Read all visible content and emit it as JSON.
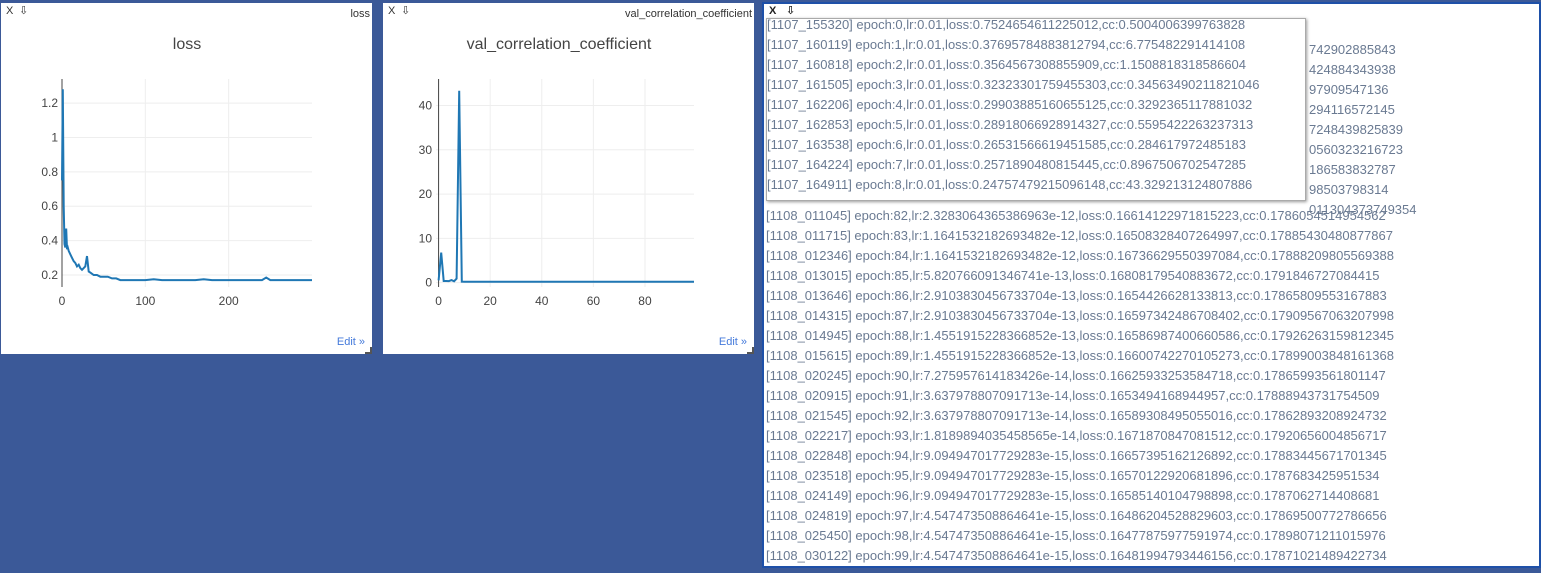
{
  "loss_pane": {
    "close_label": "X",
    "save_icon": "download-icon",
    "small_title": "loss",
    "edit_label": "Edit »",
    "chart_data": {
      "type": "line",
      "title": "loss",
      "xlabel": "",
      "ylabel": "",
      "xlim": [
        0,
        300
      ],
      "ylim": [
        0.13,
        1.34
      ],
      "xticks": [
        0,
        100,
        200
      ],
      "yticks": [
        0.2,
        0.4,
        0.6,
        0.8,
        1,
        1.2
      ],
      "grid": true,
      "color": "#1f77b4",
      "series": [
        {
          "x": [
            0,
            1,
            2,
            3,
            4,
            5,
            6,
            7,
            8,
            9,
            10,
            12,
            14,
            16,
            18,
            20,
            22,
            24,
            26,
            28,
            30,
            32,
            35,
            38,
            42,
            46,
            50,
            55,
            60,
            65,
            70,
            80,
            90,
            100,
            110,
            120,
            140,
            160,
            170,
            180,
            200,
            220,
            240,
            245,
            250,
            270,
            290,
            300
          ],
          "y": [
            0.75,
            1.28,
            0.6,
            0.38,
            0.36,
            0.47,
            0.35,
            0.36,
            0.34,
            0.33,
            0.32,
            0.3,
            0.28,
            0.27,
            0.25,
            0.26,
            0.24,
            0.23,
            0.24,
            0.25,
            0.31,
            0.22,
            0.21,
            0.2,
            0.2,
            0.19,
            0.19,
            0.19,
            0.18,
            0.18,
            0.17,
            0.17,
            0.17,
            0.17,
            0.175,
            0.17,
            0.17,
            0.17,
            0.175,
            0.17,
            0.17,
            0.17,
            0.17,
            0.185,
            0.17,
            0.17,
            0.17,
            0.17
          ]
        }
      ]
    }
  },
  "cc_pane": {
    "close_label": "X",
    "save_icon": "download-icon",
    "small_title": "val_correlation_coefficient",
    "edit_label": "Edit »",
    "chart_data": {
      "type": "line",
      "title": "val_correlation_coefficient",
      "xlabel": "",
      "ylabel": "",
      "xlim": [
        -1,
        99
      ],
      "ylim": [
        -1,
        46
      ],
      "xticks": [
        0,
        20,
        40,
        60,
        80
      ],
      "yticks": [
        0,
        10,
        20,
        30,
        40
      ],
      "grid": true,
      "color": "#1f77b4",
      "series": [
        {
          "x": [
            0,
            1,
            2,
            3,
            4,
            5,
            6,
            7,
            8,
            9,
            10,
            15,
            20,
            30,
            40,
            50,
            60,
            70,
            80,
            90,
            99
          ],
          "y": [
            0.5,
            6.78,
            0.36,
            0.35,
            0.33,
            0.56,
            0.28,
            0.9,
            43.33,
            0.2,
            0.18,
            0.18,
            0.18,
            0.18,
            0.18,
            0.18,
            0.18,
            0.18,
            0.18,
            0.18,
            0.18
          ]
        }
      ]
    }
  },
  "log_pane": {
    "close_label": "X",
    "save_icon": "download-icon",
    "tooltip_lines": [
      "[1107_155320] epoch:0,lr:0.01,loss:0.7524654611225012,cc:0.5004006399763828",
      "[1107_160119] epoch:1,lr:0.01,loss:0.37695784883812794,cc:6.775482291414108",
      "[1107_160818] epoch:2,lr:0.01,loss:0.3564567308855909,cc:1.1508818318586604",
      "[1107_161505] epoch:3,lr:0.01,loss:0.32323301759455303,cc:0.34563490211821046",
      "[1107_162206] epoch:4,lr:0.01,loss:0.29903885160655125,cc:0.3292365117881032",
      "[1107_162853] epoch:5,lr:0.01,loss:0.28918066928914327,cc:0.5595422263237313",
      "[1107_163538] epoch:6,lr:0.01,loss:0.26531566619451585,cc:0.284617972485183",
      "[1107_164224] epoch:7,lr:0.01,loss:0.2571890480815445,cc:0.8967506702547285",
      "[1107_164911] epoch:8,lr:0.01,loss:0.24757479215096148,cc:43.329213124807886"
    ],
    "bg_partial_lines": [
      "",
      "742902885843",
      "424884343938",
      "97909547136",
      "294116572145",
      "7248439825839",
      "0560323216723",
      "186583832787",
      "98503798314",
      "011304373749354"
    ],
    "lines": [
      "[1108_011045] epoch:82,lr:2.3283064365386963e-12,loss:0.16614122971815223,cc:0.1786054514954562",
      "[1108_011715] epoch:83,lr:1.1641532182693482e-12,loss:0.16508328407264997,cc:0.17885430480877867",
      "[1108_012346] epoch:84,lr:1.1641532182693482e-12,loss:0.16736629550397084,cc:0.17888209805569388",
      "[1108_013015] epoch:85,lr:5.820766091346741e-13,loss:0.16808179540883672,cc:0.1791846727084415",
      "[1108_013646] epoch:86,lr:2.9103830456733704e-13,loss:0.1654426628133813,cc:0.17865809553167883",
      "[1108_014315] epoch:87,lr:2.9103830456733704e-13,loss:0.16597342486708402,cc:0.17909567063207998",
      "[1108_014945] epoch:88,lr:1.4551915228366852e-13,loss:0.16586987400660586,cc:0.17926263159812345",
      "[1108_015615] epoch:89,lr:1.4551915228366852e-13,loss:0.16600742270105273,cc:0.17899003848161368",
      "[1108_020245] epoch:90,lr:7.275957614183426e-14,loss:0.16625933253584718,cc:0.17865993561801147",
      "[1108_020915] epoch:91,lr:3.637978807091713e-14,loss:0.1653494168944957,cc:0.17888943731754509",
      "[1108_021545] epoch:92,lr:3.637978807091713e-14,loss:0.16589308495055016,cc:0.17862893208924732",
      "[1108_022217] epoch:93,lr:1.8189894035458565e-14,loss:0.1671870847081512,cc:0.17920656004856717",
      "[1108_022848] epoch:94,lr:9.094947017729283e-15,loss:0.16657395162126892,cc:0.17883445671701345",
      "[1108_023518] epoch:95,lr:9.094947017729283e-15,loss:0.16570122920681896,cc:0.1787683425951534",
      "[1108_024149] epoch:96,lr:9.094947017729283e-15,loss:0.16585140104798898,cc:0.1787062714408681",
      "[1108_024819] epoch:97,lr:4.547473508864641e-15,loss:0.16486204528829603,cc:0.17869500772786656",
      "[1108_025450] epoch:98,lr:4.547473508864641e-15,loss:0.16477875977591974,cc:0.17898071211015976",
      "[1108_030122] epoch:99,lr:4.547473508864641e-15,loss:0.16481994793446156,cc:0.17871021489422734"
    ]
  }
}
